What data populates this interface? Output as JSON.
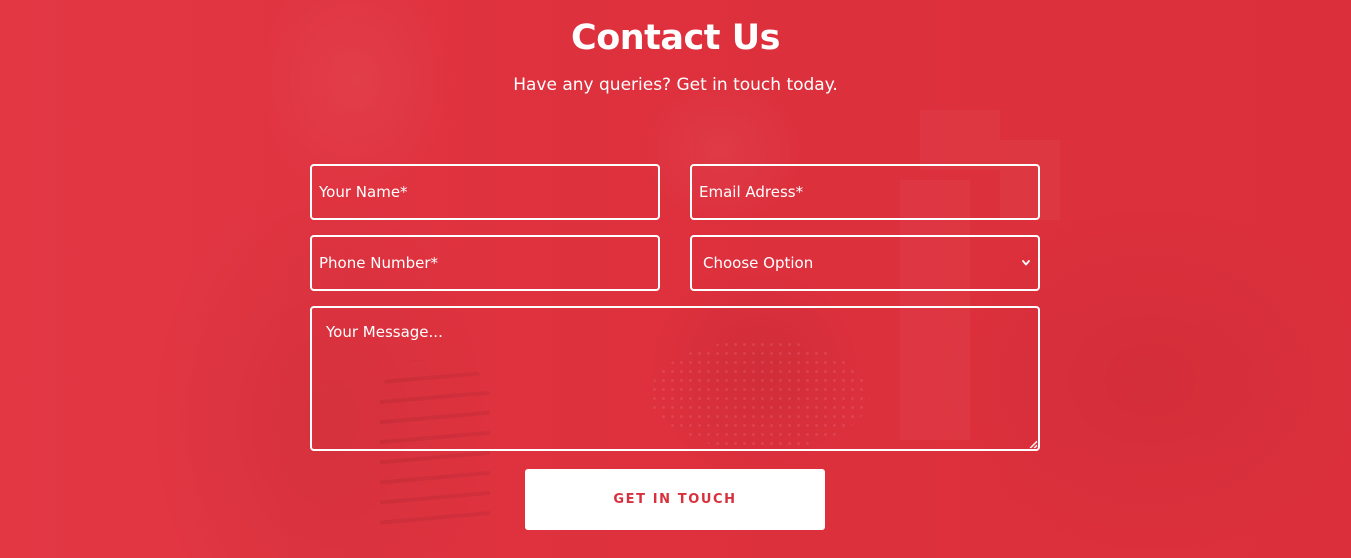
{
  "section": {
    "title": "Contact Us",
    "subtitle": "Have any queries? Get in touch today."
  },
  "form": {
    "name_placeholder": "Your Name*",
    "email_placeholder": "Email Adress*",
    "phone_placeholder": "Phone Number*",
    "option_select": {
      "selected": "Choose Option",
      "icon": "chevron-down-icon"
    },
    "message_placeholder": "Your Message...",
    "submit_label": "GET IN TOUCH"
  },
  "colors": {
    "background": "#e2313e",
    "field_border": "#ffffff",
    "button_background": "#ffffff",
    "button_text": "#d8303c"
  }
}
